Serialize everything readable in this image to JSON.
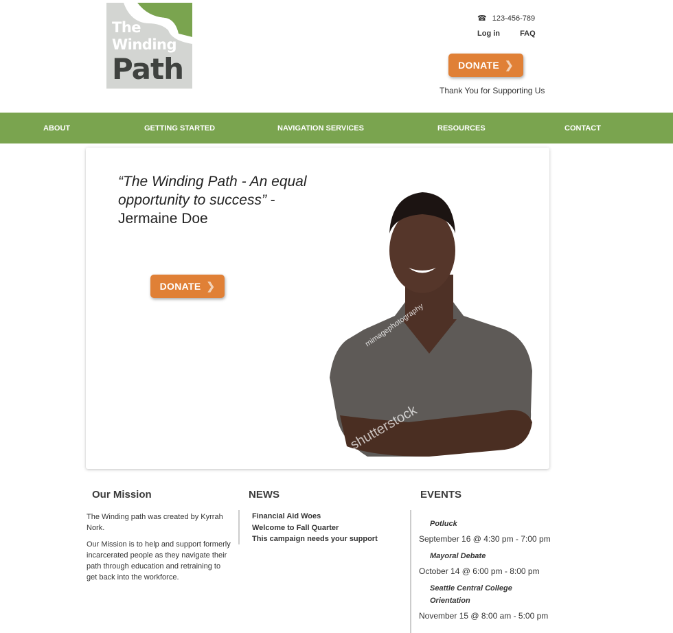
{
  "logo": {
    "line1": "The",
    "line2": "Winding",
    "line3": "Path",
    "colors": {
      "green": "#7aa44f",
      "gray": "#d3d5d2"
    }
  },
  "header": {
    "phone": "123-456-789",
    "phone_icon": "telephone-icon",
    "login": "Log in",
    "faq": "FAQ",
    "donate_label": "DONATE",
    "thanks": "Thank You for Supporting Us"
  },
  "nav": {
    "items": [
      {
        "label": "ABOUT"
      },
      {
        "label": "GETTING STARTED"
      },
      {
        "label": "NAVIGATION SERVICES"
      },
      {
        "label": "RESOURCES"
      },
      {
        "label": "CONTACT"
      }
    ]
  },
  "hero": {
    "quote": "“The Winding Path - An equal opportunity to success”",
    "dash": " -",
    "author": "Jermaine Doe",
    "donate_label": "DONATE",
    "watermarks": [
      "mimagephotography",
      "shutterstock"
    ]
  },
  "mission": {
    "title": "Our Mission",
    "p1": "The Winding path was created by Kyrrah Nork.",
    "p2": "Our Mission is to help and support formerly incarcerated people as they navigate their path through education and retraining to get back into the workforce."
  },
  "news": {
    "title": "NEWS",
    "items": [
      "Financial Aid Woes",
      "Welcome to Fall Quarter",
      "This campaign needs your support"
    ]
  },
  "events": {
    "title": "EVENTS",
    "items": [
      {
        "name": "Potluck",
        "date": "September 16 @ 4:30 pm - 7:00 pm"
      },
      {
        "name": "Mayoral Debate",
        "date": "October 14 @ 6:00 pm - 8:00 pm"
      },
      {
        "name": "Seattle Central College Orientation",
        "date": "November 15 @ 8:00 am - 5:00 pm"
      }
    ]
  }
}
